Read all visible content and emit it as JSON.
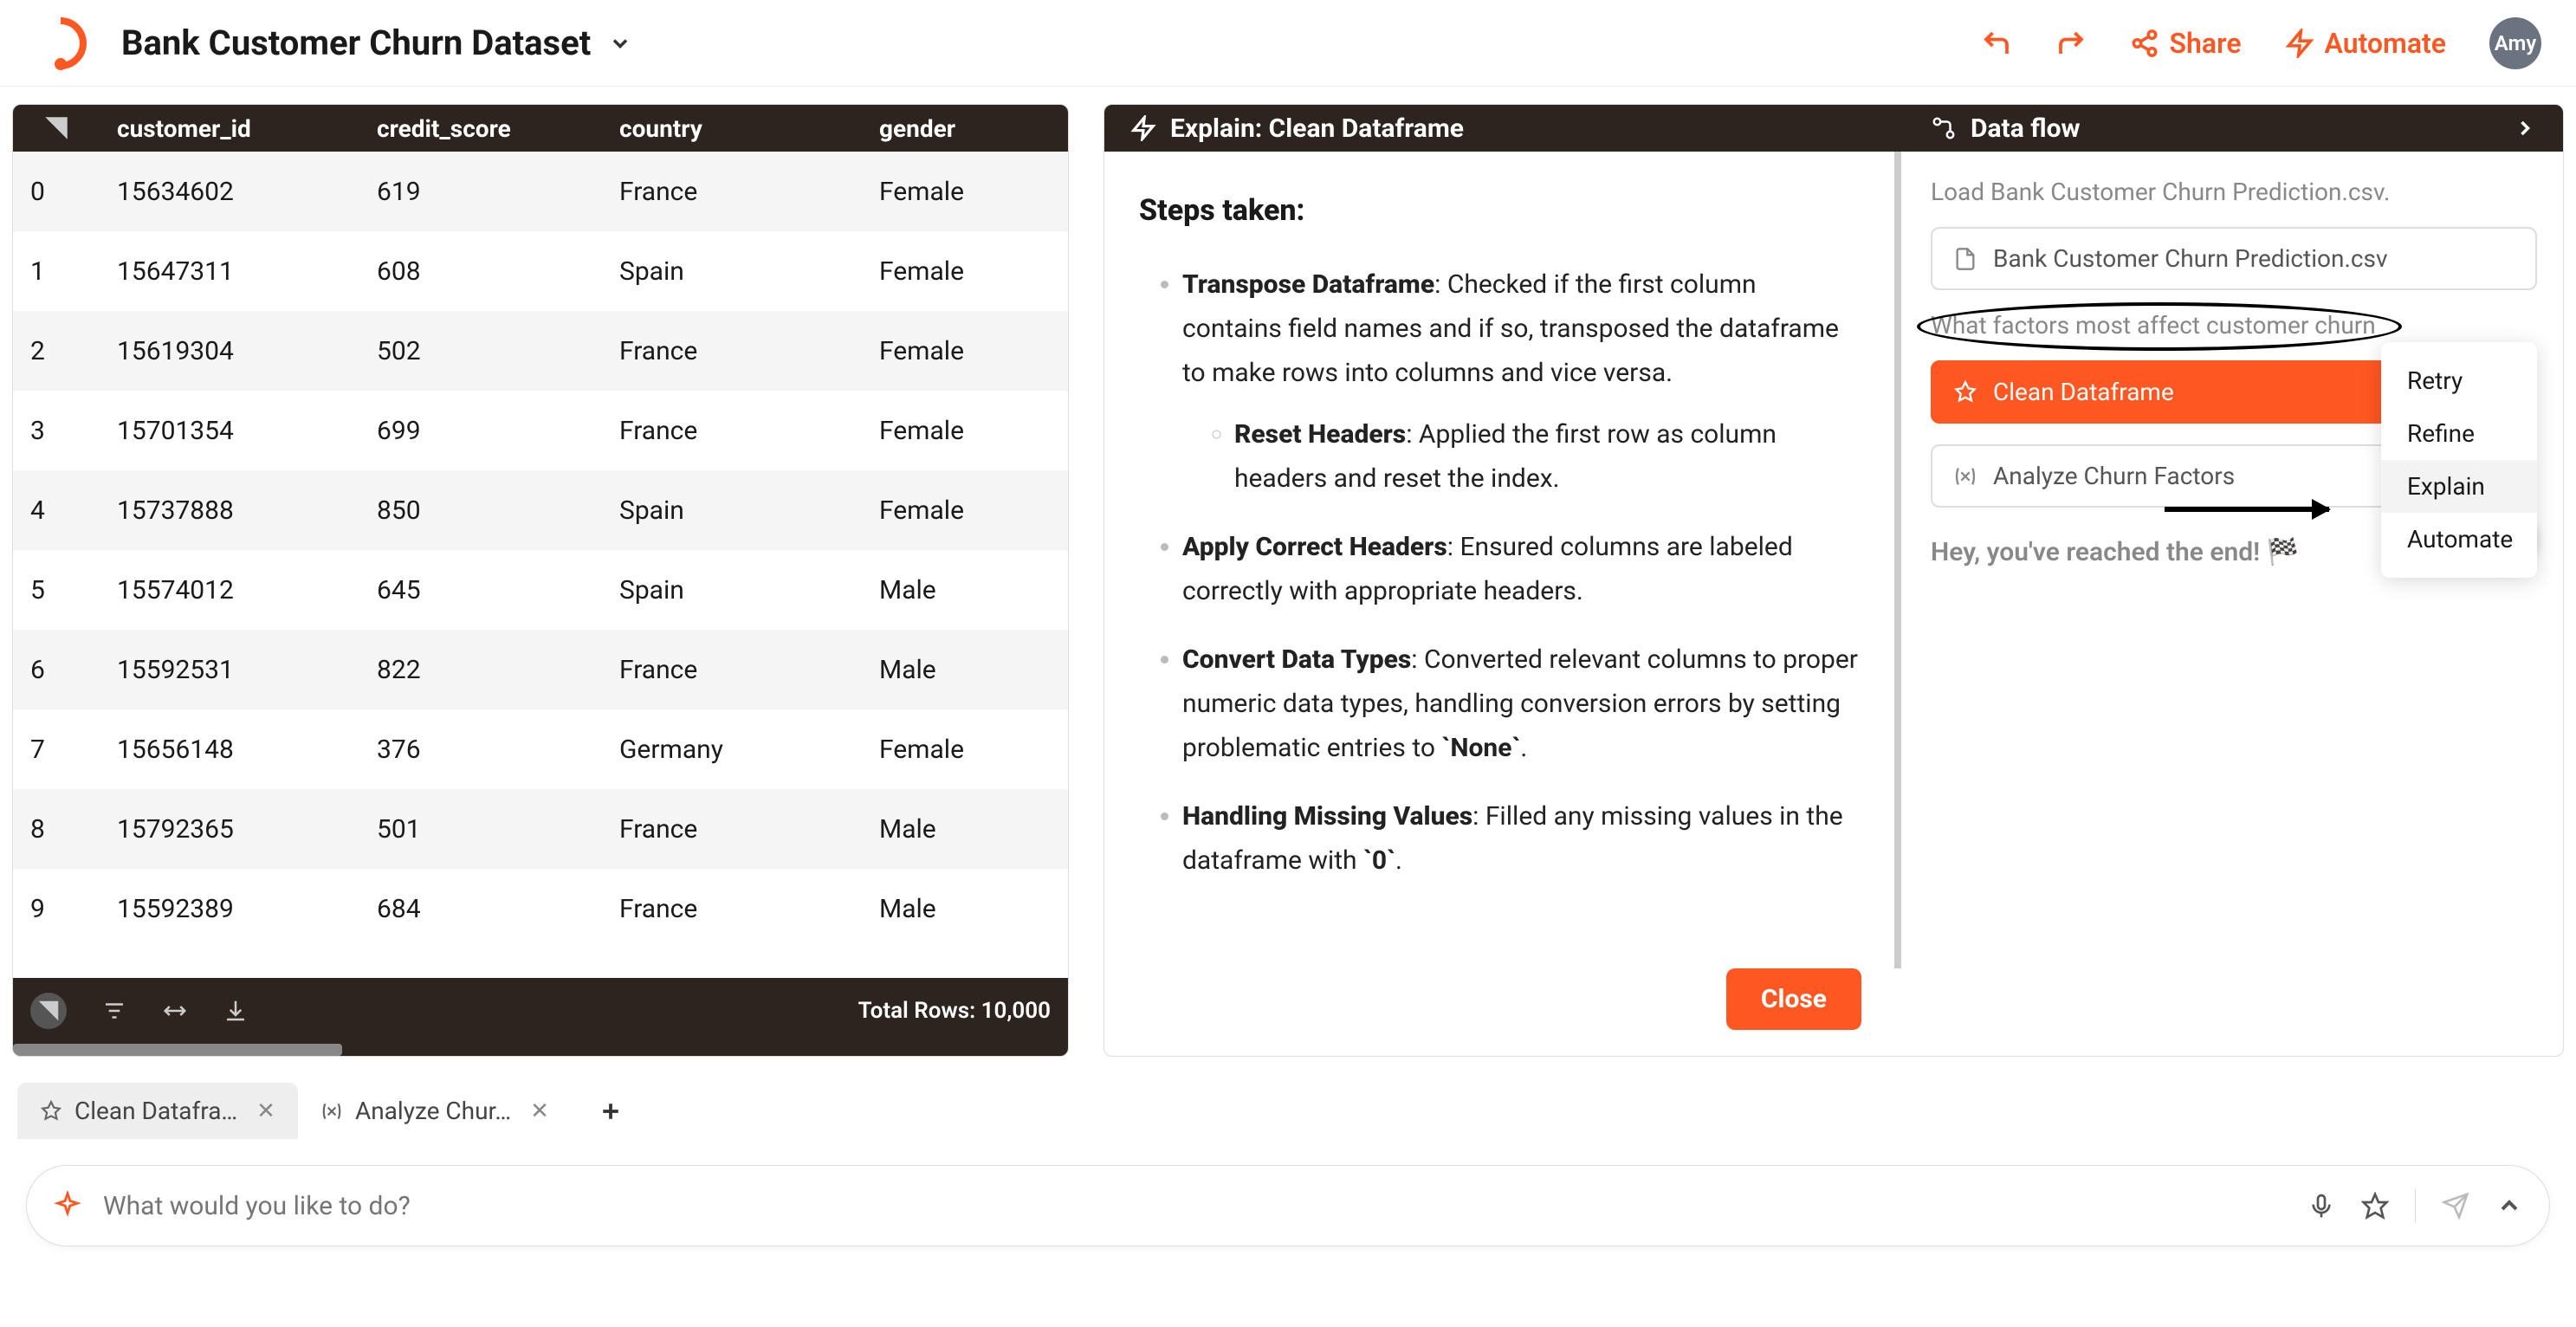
{
  "header": {
    "title": "Bank Customer Churn Dataset",
    "share": "Share",
    "automate": "Automate",
    "avatar": "Amy"
  },
  "table": {
    "columns": [
      "customer_id",
      "credit_score",
      "country",
      "gender"
    ],
    "rows": [
      {
        "idx": "0",
        "customer_id": "15634602",
        "credit_score": "619",
        "country": "France",
        "gender": "Female"
      },
      {
        "idx": "1",
        "customer_id": "15647311",
        "credit_score": "608",
        "country": "Spain",
        "gender": "Female"
      },
      {
        "idx": "2",
        "customer_id": "15619304",
        "credit_score": "502",
        "country": "France",
        "gender": "Female"
      },
      {
        "idx": "3",
        "customer_id": "15701354",
        "credit_score": "699",
        "country": "France",
        "gender": "Female"
      },
      {
        "idx": "4",
        "customer_id": "15737888",
        "credit_score": "850",
        "country": "Spain",
        "gender": "Female"
      },
      {
        "idx": "5",
        "customer_id": "15574012",
        "credit_score": "645",
        "country": "Spain",
        "gender": "Male"
      },
      {
        "idx": "6",
        "customer_id": "15592531",
        "credit_score": "822",
        "country": "France",
        "gender": "Male"
      },
      {
        "idx": "7",
        "customer_id": "15656148",
        "credit_score": "376",
        "country": "Germany",
        "gender": "Female"
      },
      {
        "idx": "8",
        "customer_id": "15792365",
        "credit_score": "501",
        "country": "France",
        "gender": "Male"
      },
      {
        "idx": "9",
        "customer_id": "15592389",
        "credit_score": "684",
        "country": "France",
        "gender": "Male"
      }
    ],
    "total_label": "Total Rows: 10,000"
  },
  "explain": {
    "header": "Explain: Clean Dataframe",
    "steps_title": "Steps taken:",
    "items": [
      {
        "bold": "Transpose Dataframe",
        "text": ": Checked if the first column contains field names and if so, transposed the dataframe to make rows into columns and vice versa.",
        "sub": {
          "bold": "Reset Headers",
          "text": ": Applied the first row as column headers and reset the index."
        }
      },
      {
        "bold": "Apply Correct Headers",
        "text": ": Ensured columns are labeled correctly with appropriate headers."
      },
      {
        "bold": "Convert Data Types",
        "text": ": Converted relevant columns to proper numeric data types, handling conversion errors by setting problematic entries to `None`."
      },
      {
        "bold": "Handling Missing Values",
        "text": ": Filled any missing values in the dataframe with `0`."
      }
    ],
    "close": "Close"
  },
  "flow": {
    "header": "Data flow",
    "load_label": "Load Bank Customer Churn Prediction.csv.",
    "file_chip": "Bank Customer Churn Prediction.csv",
    "question": "What factors most affect customer churn",
    "clean_chip": "Clean Dataframe",
    "analyze_chip": "Analyze Churn Factors",
    "end": "Hey, you've reached the end! 🏁",
    "menu": {
      "retry": "Retry",
      "refine": "Refine",
      "explain": "Explain",
      "automate": "Automate"
    }
  },
  "tabs": {
    "t1": "Clean Datafra…",
    "t2": "Analyze Chur…"
  },
  "prompt": {
    "placeholder": "What would you like to do?"
  }
}
